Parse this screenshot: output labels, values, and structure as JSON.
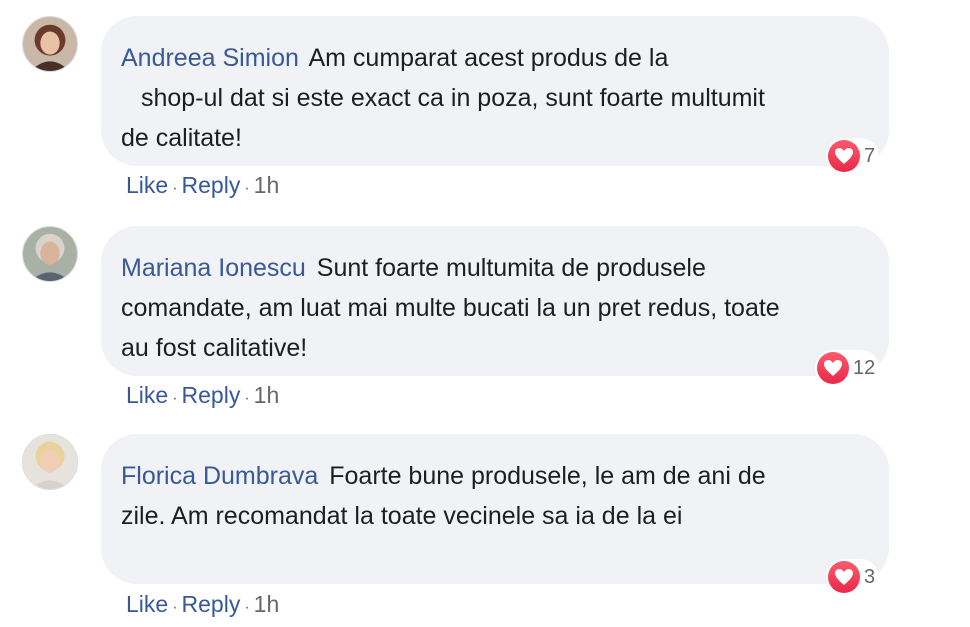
{
  "comments": [
    {
      "author": "Andreea Simion",
      "lines": [
        "Am cumparat acest produs de la",
        "shop-ul dat si este exact ca in poza, sunt foarte multumit",
        "de calitate!"
      ],
      "reaction_count": "7",
      "like_label": "Like",
      "reply_label": "Reply",
      "time": "1h"
    },
    {
      "author": "Mariana Ionescu",
      "lines": [
        "Sunt foarte multumita de produsele",
        "comandate, am luat mai multe bucati la un pret redus, toate",
        "au fost calitative!"
      ],
      "reaction_count": "12",
      "like_label": "Like",
      "reply_label": "Reply",
      "time": "1h"
    },
    {
      "author": "Florica Dumbrava",
      "lines": [
        "Foarte bune produsele, le am de ani de",
        "zile. Am recomandat la toate vecinele sa ia de la  ei"
      ],
      "reaction_count": "3",
      "like_label": "Like",
      "reply_label": "Reply",
      "time": "1h"
    }
  ],
  "colors": {
    "author": "#385898",
    "bubble": "#f0f2f5",
    "heart": "#e8284a",
    "meta": "#65676b"
  }
}
